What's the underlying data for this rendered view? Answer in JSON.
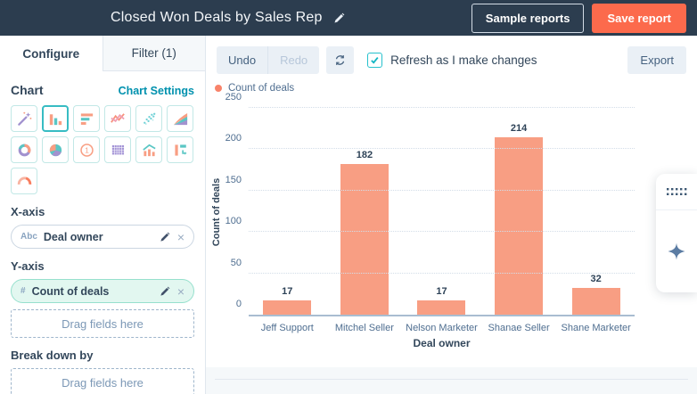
{
  "topbar": {
    "title": "Closed Won Deals by Sales Rep",
    "sample_reports_label": "Sample reports",
    "save_report_label": "Save report"
  },
  "sidebar": {
    "tab_configure": "Configure",
    "tab_filter": "Filter (1)",
    "chart_heading": "Chart",
    "chart_settings_link": "Chart Settings",
    "chart_types": [
      {
        "name": "magic-wand",
        "selected": false
      },
      {
        "name": "column-chart",
        "selected": true
      },
      {
        "name": "horizontal-bar-chart",
        "selected": false
      },
      {
        "name": "line-chart",
        "selected": false
      },
      {
        "name": "scatter-chart",
        "selected": false
      },
      {
        "name": "area-chart",
        "selected": false
      },
      {
        "name": "donut-chart",
        "selected": false
      },
      {
        "name": "pie-chart",
        "selected": false
      },
      {
        "name": "kpi-number",
        "selected": false
      },
      {
        "name": "table",
        "selected": false
      },
      {
        "name": "combo-chart",
        "selected": false
      },
      {
        "name": "pivot-table",
        "selected": false
      },
      {
        "name": "gauge-chart",
        "selected": false
      }
    ],
    "x_axis": {
      "heading": "X-axis",
      "field_type": "Abc",
      "field_name": "Deal owner"
    },
    "y_axis": {
      "heading": "Y-axis",
      "field_type": "#",
      "field_name": "Count of deals",
      "drop_placeholder": "Drag fields here"
    },
    "break_down": {
      "heading": "Break down by",
      "drop_placeholder": "Drag fields here"
    }
  },
  "toolbar": {
    "undo_label": "Undo",
    "redo_label": "Redo",
    "refresh_checkbox_checked": true,
    "refresh_checkbox_label": "Refresh as I make changes",
    "export_label": "Export"
  },
  "chart_data": {
    "type": "bar",
    "legend": "Count of deals",
    "categories": [
      "Jeff Support",
      "Mitchel Seller",
      "Nelson Marketer",
      "Shanae Seller",
      "Shane Marketer"
    ],
    "values": [
      17,
      182,
      17,
      214,
      32
    ],
    "xlabel": "Deal owner",
    "ylabel": "Count of deals",
    "ylim": [
      0,
      250
    ],
    "yticks": [
      0,
      50,
      100,
      150,
      200,
      250
    ],
    "grid": "horizontal-dotted",
    "legend_position": "top-left",
    "bar_color": "#f89e83"
  },
  "colors": {
    "topbar_bg": "#2c3d4f",
    "primary_button": "#fc6a4c",
    "teal_link": "#0091ae",
    "bar": "#f89e83",
    "selected_chart_type_border": "#37bcc3",
    "checkbox_teal": "#26c1cd"
  }
}
